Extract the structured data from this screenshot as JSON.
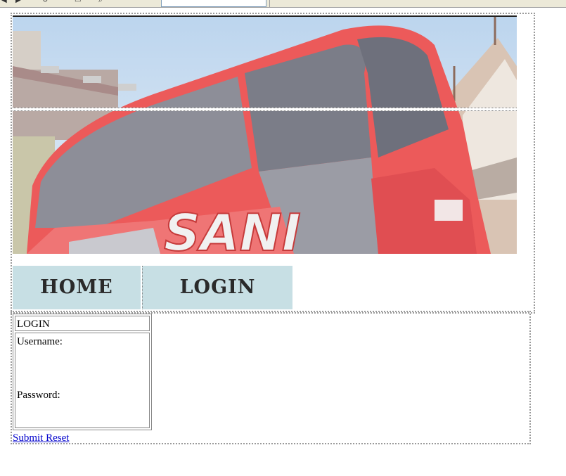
{
  "nav": {
    "home_label": "HOME",
    "login_label": "LOGIN"
  },
  "login_form": {
    "title": "LOGIN",
    "username_label": "Username:",
    "password_label": "Password:",
    "submit_label": "Submit",
    "reset_label": "Reset"
  },
  "colors": {
    "nav_bg": "#c7dfe4",
    "link": "#0000cc",
    "bus_red": "#ec5a5a",
    "sky": "#cfe0f0"
  },
  "banner": {
    "bus_text": "SANI"
  }
}
